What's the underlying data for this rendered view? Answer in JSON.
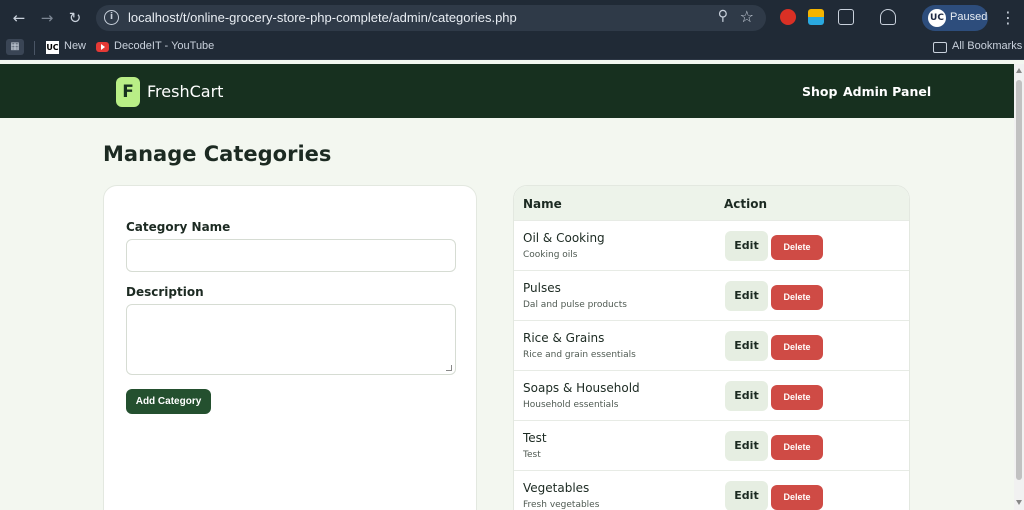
{
  "browser": {
    "url": "localhost/t/online-grocery-store-php-complete/admin/categories.php",
    "profile_status": "Paused",
    "profile_initials": "UC",
    "bookmarks": [
      {
        "label": "New",
        "icon": "uc-icon"
      },
      {
        "label": "DecodeIT - YouTube",
        "icon": "youtube-icon"
      }
    ],
    "all_bookmarks": "All Bookmarks"
  },
  "header": {
    "logo_letter": "F",
    "brand": "FreshCart",
    "nav": [
      "Shop",
      "Admin Panel"
    ]
  },
  "page": {
    "title": "Manage Categories"
  },
  "form": {
    "name_label": "Category Name",
    "name_value": "",
    "description_label": "Description",
    "description_value": "",
    "submit_label": "Add Category"
  },
  "table": {
    "columns": [
      "Name",
      "Action"
    ],
    "edit_label": "Edit",
    "delete_label": "Delete",
    "rows": [
      {
        "name": "Oil & Cooking",
        "description": "Cooking oils"
      },
      {
        "name": "Pulses",
        "description": "Dal and pulse products"
      },
      {
        "name": "Rice & Grains",
        "description": "Rice and grain essentials"
      },
      {
        "name": "Soaps & Household",
        "description": "Household essentials"
      },
      {
        "name": "Test",
        "description": "Test"
      },
      {
        "name": "Vegetables",
        "description": "Fresh vegetables"
      }
    ]
  },
  "colors": {
    "header_bg": "#17301f",
    "logo_accent": "#b9ee86",
    "primary_button": "#24502f",
    "delete_button": "#cf4b45",
    "page_bg": "#f3f7f0"
  }
}
